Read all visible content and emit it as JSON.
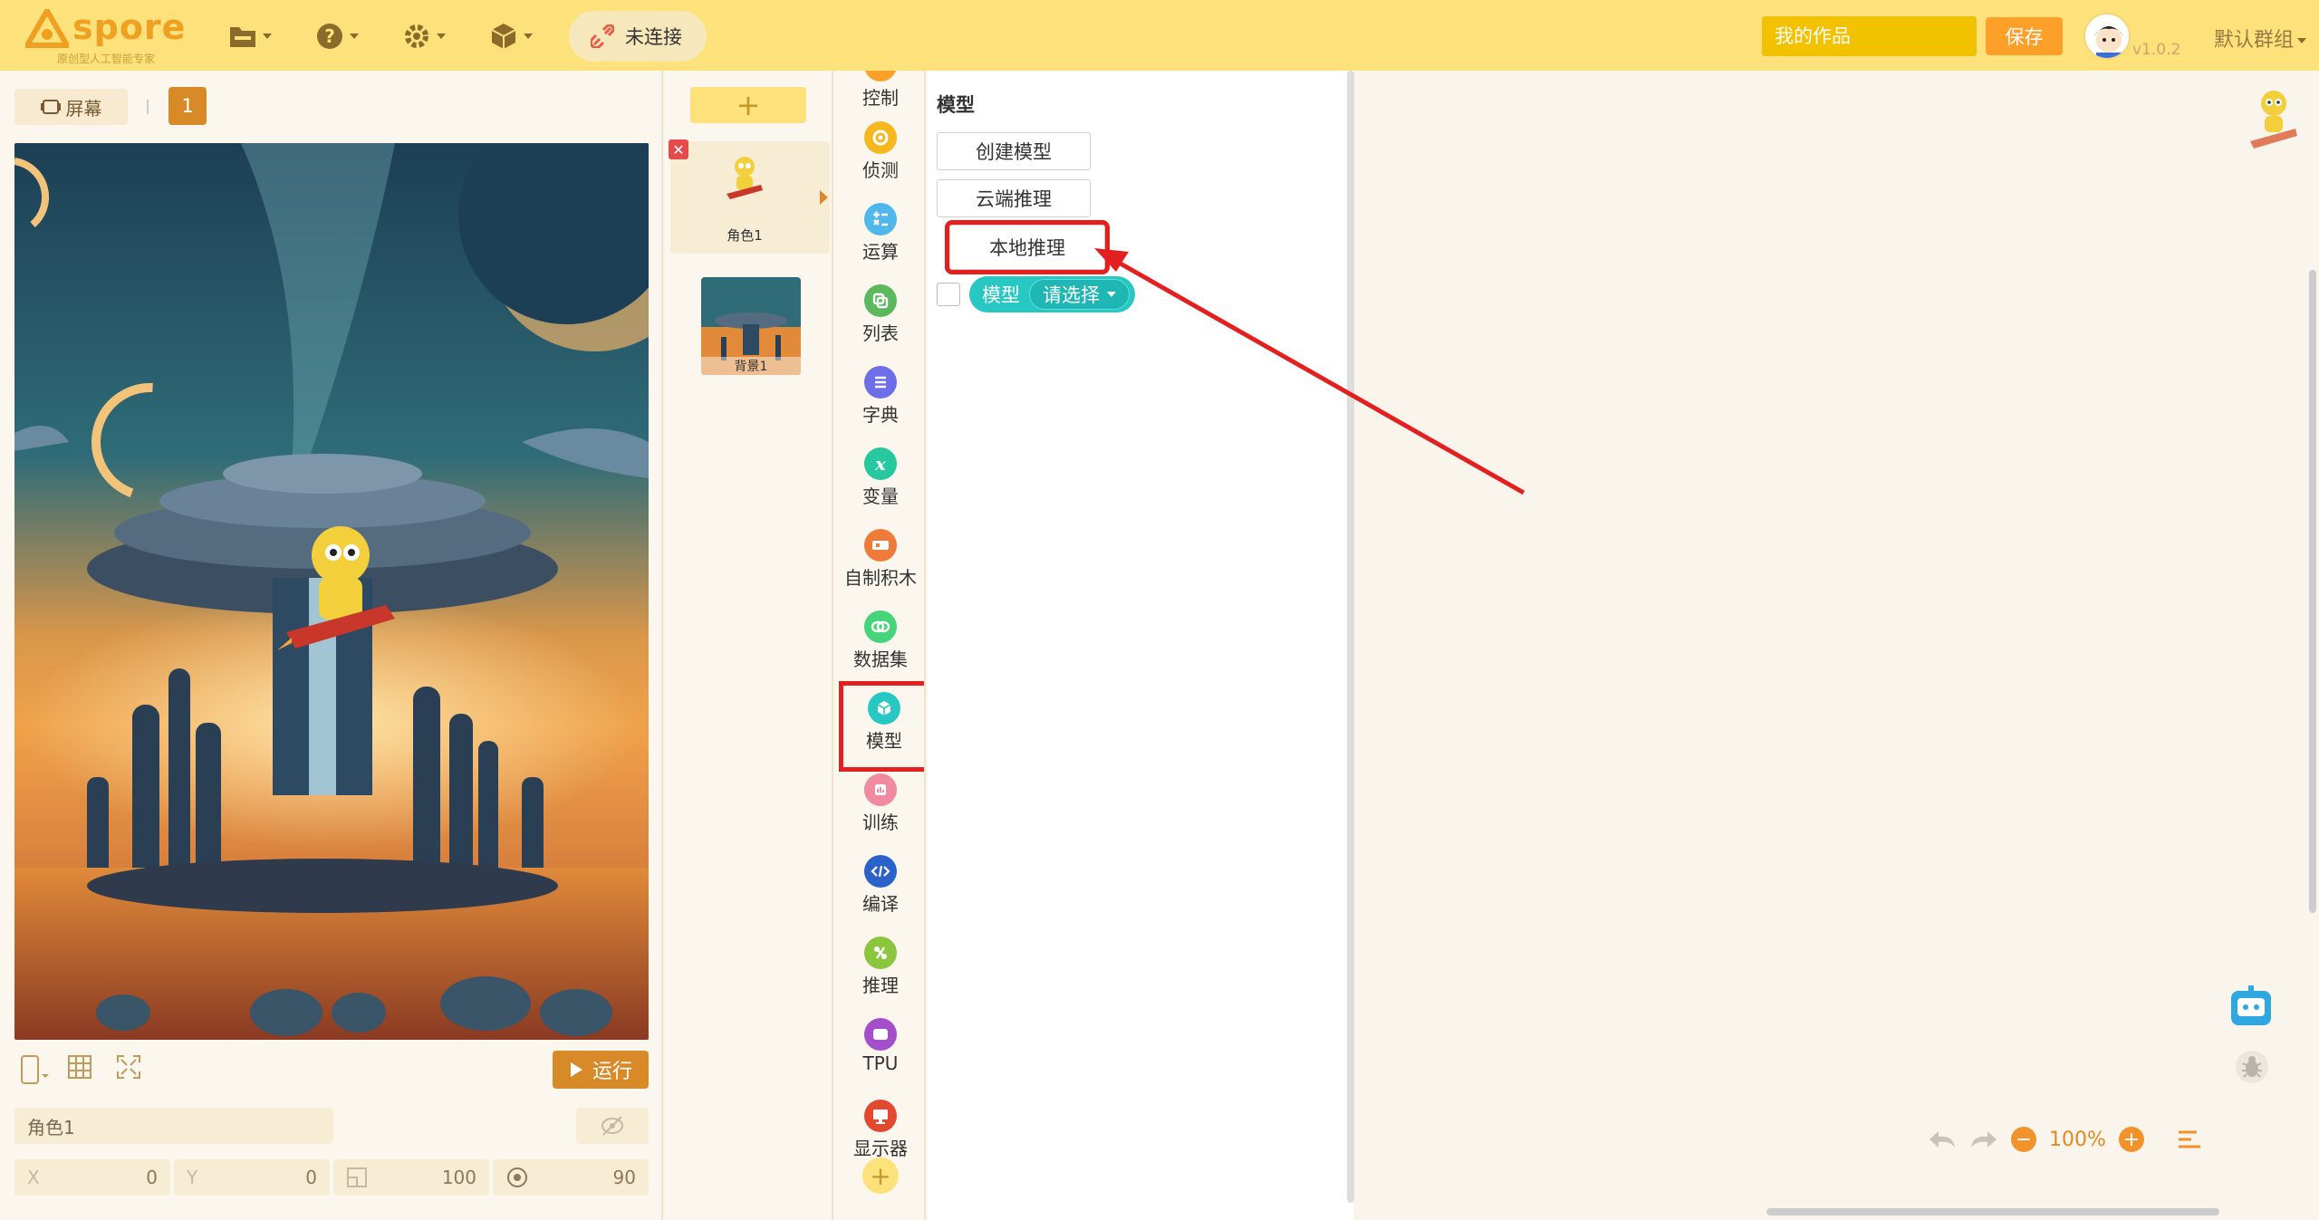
{
  "header": {
    "logo_text": "spore",
    "logo_sub": "原创型人工智能专家",
    "connection_label": "未连接",
    "work_placeholder": "我的作品",
    "save_label": "保存",
    "version": "v1.0.2",
    "group_label": "默认群组"
  },
  "stage": {
    "screen_label": "屏幕",
    "screen_number": "1",
    "run_label": "运行",
    "sprite_name": "角色1",
    "x_label": "X",
    "x_value": "0",
    "y_label": "Y",
    "y_value": "0",
    "size_value": "100",
    "direction_value": "90"
  },
  "sprites": {
    "add_label": "+",
    "items": [
      {
        "label": "角色1"
      }
    ],
    "background_label": "背景1"
  },
  "categories": {
    "items": [
      {
        "label": "控制",
        "color": "#fca02a",
        "icon": "control-icon"
      },
      {
        "label": "侦测",
        "color": "#f5b81e",
        "icon": "sensing-icon"
      },
      {
        "label": "运算",
        "color": "#4fb7ea",
        "icon": "operator-icon"
      },
      {
        "label": "列表",
        "color": "#5cb85c",
        "icon": "list-icon"
      },
      {
        "label": "字典",
        "color": "#6d6ee8",
        "icon": "dictionary-icon"
      },
      {
        "label": "变量",
        "color": "#27c7a0",
        "icon": "variable-icon"
      },
      {
        "label": "自制积木",
        "color": "#f07a3a",
        "icon": "custom-block-icon"
      },
      {
        "label": "数据集",
        "color": "#45d47a",
        "icon": "dataset-icon"
      },
      {
        "label": "模型",
        "color": "#27c7c4",
        "icon": "model-icon"
      },
      {
        "label": "训练",
        "color": "#f08aa0",
        "icon": "training-icon"
      },
      {
        "label": "编译",
        "color": "#2a62c9",
        "icon": "compile-icon"
      },
      {
        "label": "推理",
        "color": "#8cc63e",
        "icon": "inference-icon"
      },
      {
        "label": "TPU",
        "color": "#a54ec9",
        "icon": "tpu-icon"
      },
      {
        "label": "显示器",
        "color": "#e3492e",
        "icon": "display-icon"
      }
    ]
  },
  "palette": {
    "title": "模型",
    "buttons": [
      "创建模型",
      "云端推理",
      "本地推理"
    ],
    "block_label": "模型",
    "block_dropdown": "请选择"
  },
  "workspace": {
    "zoom": "100%"
  }
}
